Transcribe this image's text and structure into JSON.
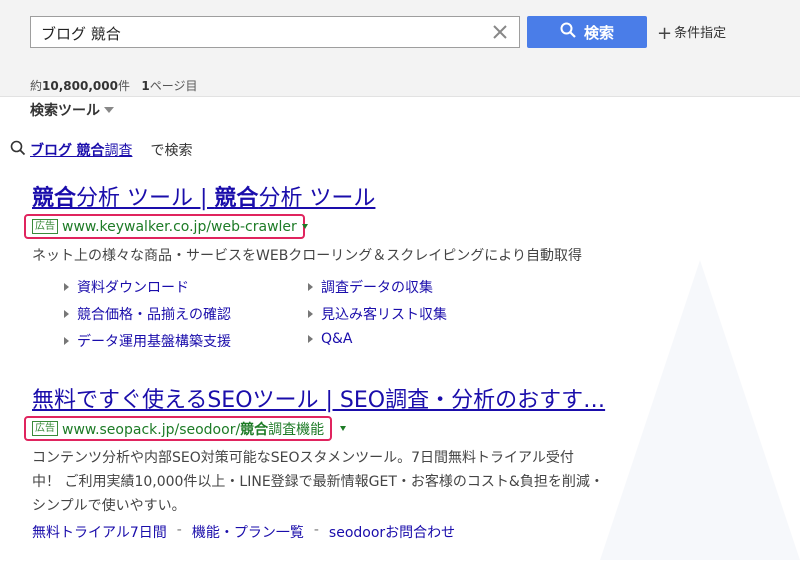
{
  "search": {
    "query": "ブログ 競合",
    "button_label": "検索",
    "conditions_label": "条件指定",
    "result_count_prefix": "約",
    "result_count": "10,800,000",
    "result_count_suffix": "件",
    "page_number": "1",
    "page_suffix": "ページ目",
    "tools_label": "検索ツール"
  },
  "suggestion": {
    "query_part1": "ブログ",
    "query_part2": "競合",
    "query_part3": "調査",
    "tail": "で検索"
  },
  "ads": [
    {
      "title_part1": "競合",
      "title_part2": "分析 ツール | ",
      "title_part3": "競合",
      "title_part4": "分析 ツール",
      "badge": "広告",
      "url": "www.keywalker.co.jp/web-crawler",
      "description": "ネット上の様々な商品・サービスをWEBクローリング＆スクレイピングにより自動取得",
      "sitelinks": [
        "資料ダウンロード",
        "調査データの収集",
        "競合価格・品揃えの確認",
        "見込み客リスト収集",
        "データ運用基盤構築支援",
        "Q&A"
      ]
    },
    {
      "title": "無料ですぐ使えるSEOツール | SEO調査・分析のおすす…",
      "badge": "広告",
      "url_part1": "www.seopack.jp/seodoor/",
      "url_part2": "競合",
      "url_part3": "調査機能",
      "description_line1": "コンテンツ分析や内部SEO対策可能なSEOスタメンツール。7日間無料トライアル受付",
      "description_line2": "中！ ご利用実績10,000件以上・LINE登録で最新情報GET・お客様のコスト&負担を削減・",
      "description_line3": "シンプルで使いやすい。",
      "bottom_links": [
        "無料トライアル7日間",
        "機能・プラン一覧",
        "seodoorお問合わせ"
      ],
      "separator": "-"
    }
  ],
  "colors": {
    "link": "#1a0dab",
    "url_green": "#1d7b26",
    "highlight_border": "#e0245e",
    "search_button": "#4a7de8"
  }
}
